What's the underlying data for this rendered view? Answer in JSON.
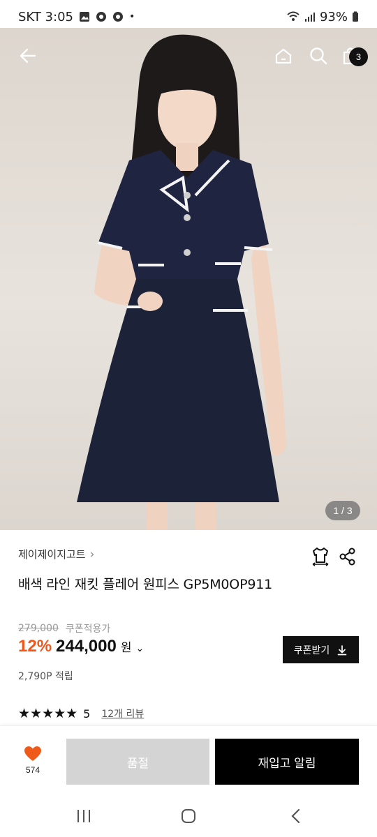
{
  "status_bar": {
    "time_text": "SKT 3:05",
    "battery": "93%"
  },
  "header": {
    "icons": [
      "back-arrow-icon",
      "home-icon",
      "search-icon",
      "shopping-bag-icon"
    ],
    "cart_count": "3"
  },
  "gallery": {
    "page_indicator": "1 / 3"
  },
  "product": {
    "brand": "제이제이지고트",
    "title": "배색 라인 재킷 플레어 원피스 GP5M0OP911",
    "original_price": "279,000",
    "coupon_label": "쿠폰적용가",
    "discount": "12%",
    "price": "244,000",
    "currency": "원",
    "coupon_button": "쿠폰받기",
    "points": "2,790P 적립",
    "rating_stars": "★★★★★",
    "rating_value": "5",
    "review_link": "12개 리뷰"
  },
  "action_bar": {
    "like_count": "574",
    "soldout_label": "품절",
    "restock_label": "재입고 알림"
  },
  "colors": {
    "accent": "#f1561a",
    "heart": "#ef5a1a",
    "soldout": "#d4d4d4",
    "primary_button": "#000000"
  }
}
